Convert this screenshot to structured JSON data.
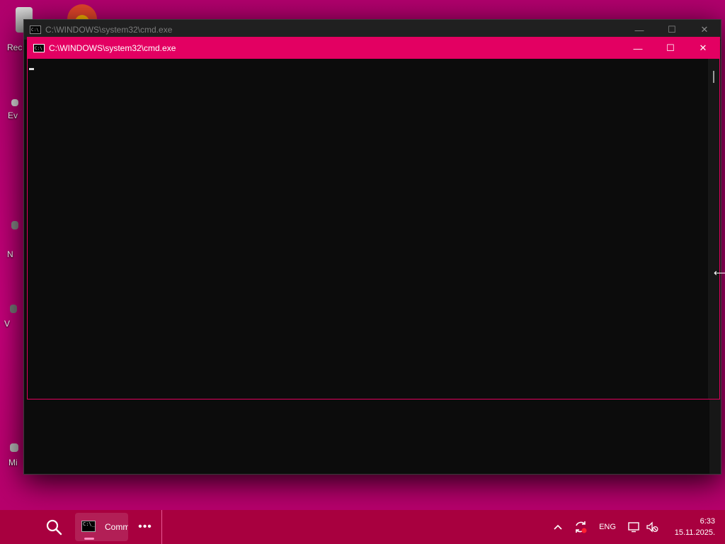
{
  "desktop": {
    "icons": [
      {
        "label": "Rec",
        "icon": "recycle-bin-icon"
      },
      {
        "label": "",
        "icon": "browser-icon"
      },
      {
        "label": "Ev",
        "icon": "shortcut-icon"
      },
      {
        "label": "N",
        "icon": "shortcut-icon"
      },
      {
        "label": "V",
        "icon": "shortcut-icon"
      },
      {
        "label": "Mi",
        "icon": "shortcut-icon"
      }
    ]
  },
  "back_window": {
    "title": "C:\\WINDOWS\\system32\\cmd.exe",
    "app_icon_text": "C:\\",
    "minimize": "—",
    "maximize": "☐",
    "close": "✕"
  },
  "front_window": {
    "title": "C:\\WINDOWS\\system32\\cmd.exe",
    "app_icon_text": "C:\\",
    "minimize": "—",
    "maximize": "☐",
    "close": "✕",
    "console_text": ""
  },
  "taskbar": {
    "task_label": "Command Prompt",
    "task_icon_text": "C:\\_",
    "more": "•••",
    "tray": {
      "show_hidden": "^",
      "language": "ENG"
    },
    "clock": {
      "time": "6:33",
      "date": "15.11.2025."
    }
  },
  "colors": {
    "desktop": "#c5007a",
    "taskbar": "#a8003f",
    "active_titlebar": "#e30062",
    "console_bg": "#0c0c0c"
  }
}
